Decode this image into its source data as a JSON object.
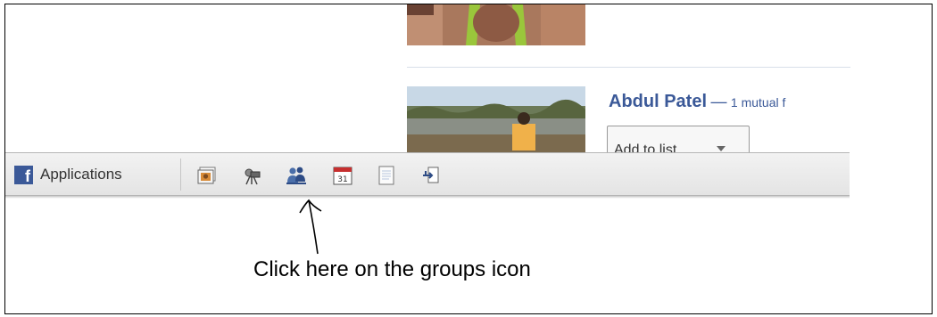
{
  "profile": {
    "name": "Abdul Patel",
    "separator": "—",
    "mutual_text": "1 mutual f",
    "add_to_list_label": "Add to list..."
  },
  "taskbar": {
    "applications_label": "Applications",
    "fb_logo_letter": "f",
    "icons": [
      "photos-icon",
      "video-icon",
      "groups-icon",
      "events-icon",
      "notes-icon",
      "share-icon"
    ],
    "calendar_day": "31"
  },
  "annotation": {
    "instruction": "Click here on the groups icon"
  },
  "colors": {
    "facebook_blue": "#3b5998",
    "taskbar_bg": "#e9e9e9"
  }
}
